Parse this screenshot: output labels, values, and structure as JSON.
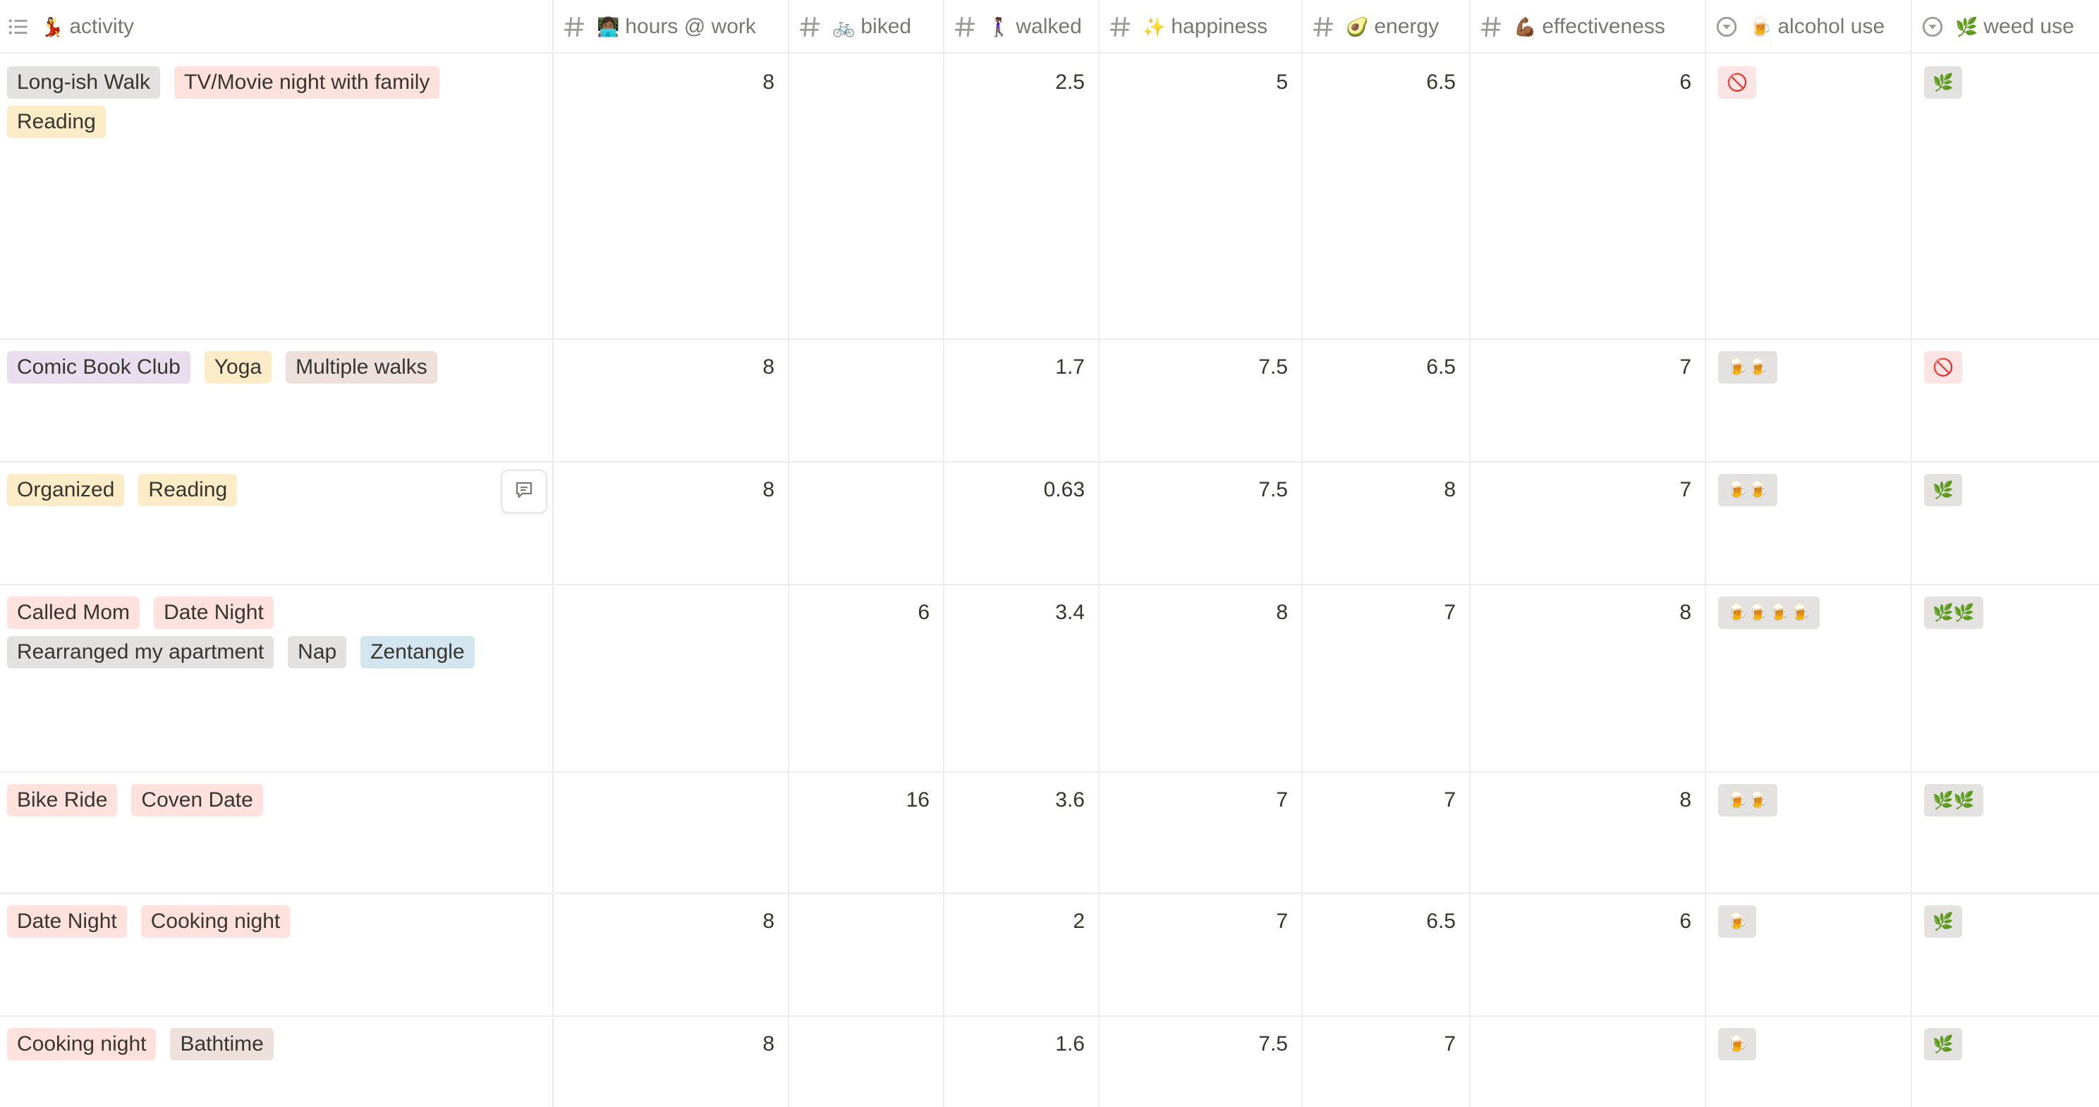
{
  "columns": [
    {
      "key": "activity",
      "icon": "list-icon",
      "emoji": "💃",
      "label": "activity"
    },
    {
      "key": "work",
      "icon": "hash-icon",
      "emoji": "👩🏾‍💻",
      "label": "hours @ work"
    },
    {
      "key": "biked",
      "icon": "hash-icon",
      "emoji": "🚲",
      "label": "biked"
    },
    {
      "key": "walked",
      "icon": "hash-icon",
      "emoji": "🚶🏾‍♀️",
      "label": "walked"
    },
    {
      "key": "happiness",
      "icon": "hash-icon",
      "emoji": "✨",
      "label": "happiness"
    },
    {
      "key": "energy",
      "icon": "hash-icon",
      "emoji": "🥑",
      "label": "energy"
    },
    {
      "key": "effectiveness",
      "icon": "hash-icon",
      "emoji": "💪🏾",
      "label": "effectiveness"
    },
    {
      "key": "alcohol",
      "icon": "select-icon",
      "emoji": "🍺",
      "label": "alcohol use"
    },
    {
      "key": "weed",
      "icon": "select-icon",
      "emoji": "🌿",
      "label": "weed use"
    }
  ],
  "colors": {
    "gray": "#e3e2e0",
    "red": "#ffe2dd",
    "yellow": "#fdecc8",
    "purple": "#e8deee",
    "brown": "#eee0da",
    "blue": "#d3e5ef"
  },
  "rows": [
    {
      "activity": [
        {
          "label": "Long-ish Walk",
          "color": "gray"
        },
        {
          "label": "TV/Movie night with family",
          "color": "red"
        },
        {
          "label": "Reading",
          "color": "yellow"
        }
      ],
      "work": "8",
      "biked": "",
      "walked": "2.5",
      "happiness": "5",
      "energy": "6.5",
      "effectiveness": "6",
      "alcohol": {
        "value": "🚫",
        "color": "red"
      },
      "weed": {
        "value": "🌿",
        "color": "gray"
      }
    },
    {
      "activity": [
        {
          "label": "Comic Book Club",
          "color": "purple"
        },
        {
          "label": "Yoga",
          "color": "yellow"
        },
        {
          "label": "Multiple walks",
          "color": "brown"
        }
      ],
      "work": "8",
      "biked": "",
      "walked": "1.7",
      "happiness": "7.5",
      "energy": "6.5",
      "effectiveness": "7",
      "alcohol": {
        "value": "🍺🍺",
        "color": "gray"
      },
      "weed": {
        "value": "🚫",
        "color": "red"
      }
    },
    {
      "activity": [
        {
          "label": "Organized",
          "color": "yellow"
        },
        {
          "label": "Reading",
          "color": "yellow"
        }
      ],
      "work": "8",
      "biked": "",
      "walked": "0.63",
      "happiness": "7.5",
      "energy": "8",
      "effectiveness": "7",
      "alcohol": {
        "value": "🍺🍺",
        "color": "gray"
      },
      "weed": {
        "value": "🌿",
        "color": "gray"
      },
      "hovered": true
    },
    {
      "activity": [
        {
          "label": "Called Mom",
          "color": "red"
        },
        {
          "label": "Date Night",
          "color": "red"
        },
        {
          "label": "Rearranged my apartment",
          "color": "gray"
        },
        {
          "label": "Nap",
          "color": "gray"
        },
        {
          "label": "Zentangle",
          "color": "blue"
        }
      ],
      "work": "",
      "biked": "6",
      "walked": "3.4",
      "happiness": "8",
      "energy": "7",
      "effectiveness": "8",
      "alcohol": {
        "value": "🍺🍺🍺🍺",
        "color": "gray"
      },
      "weed": {
        "value": "🌿🌿",
        "color": "gray"
      }
    },
    {
      "activity": [
        {
          "label": "Bike Ride",
          "color": "red"
        },
        {
          "label": "Coven Date",
          "color": "red"
        }
      ],
      "work": "",
      "biked": "16",
      "walked": "3.6",
      "happiness": "7",
      "energy": "7",
      "effectiveness": "8",
      "alcohol": {
        "value": "🍺🍺",
        "color": "gray"
      },
      "weed": {
        "value": "🌿🌿",
        "color": "gray"
      }
    },
    {
      "activity": [
        {
          "label": "Date Night",
          "color": "red"
        },
        {
          "label": "Cooking night",
          "color": "red"
        }
      ],
      "work": "8",
      "biked": "",
      "walked": "2",
      "happiness": "7",
      "energy": "6.5",
      "effectiveness": "6",
      "alcohol": {
        "value": "🍺",
        "color": "gray"
      },
      "weed": {
        "value": "🌿",
        "color": "gray"
      }
    },
    {
      "activity": [
        {
          "label": "Cooking night",
          "color": "red"
        },
        {
          "label": "Bathtime",
          "color": "brown"
        }
      ],
      "work": "8",
      "biked": "",
      "walked": "1.6",
      "happiness": "7.5",
      "energy": "7",
      "effectiveness": "",
      "alcohol": {
        "value": "🍺",
        "color": "gray"
      },
      "weed": {
        "value": "🌿",
        "color": "gray"
      }
    }
  ]
}
